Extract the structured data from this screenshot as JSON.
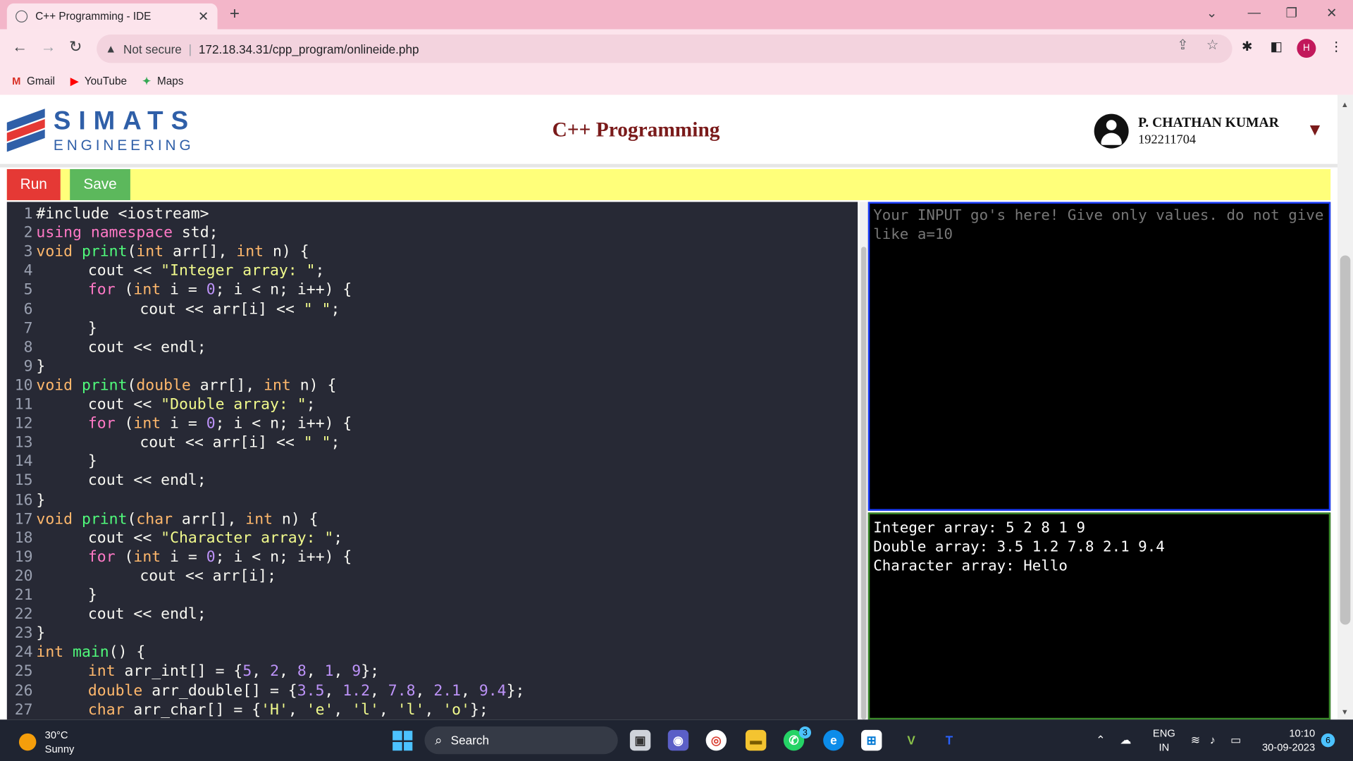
{
  "browser": {
    "tab_title": "C++ Programming - IDE",
    "new_tab": "+",
    "security": "Not secure",
    "url": "172.18.34.31/cpp_program/onlineide.php",
    "avatar_initial": "H",
    "bookmarks": [
      {
        "label": "Gmail",
        "icon": "gmail-icon"
      },
      {
        "label": "YouTube",
        "icon": "youtube-icon"
      },
      {
        "label": "Maps",
        "icon": "maps-icon"
      }
    ]
  },
  "header": {
    "logo_line1": "SIMATS",
    "logo_line2": "ENGINEERING",
    "title": "C++ Programming",
    "user_name": "P. CHATHAN KUMAR",
    "user_id": "192211704"
  },
  "actions": {
    "run_label": "Run",
    "save_label": "Save"
  },
  "input": {
    "placeholder": "Your INPUT go's here! Give only values. do not give like a=10"
  },
  "output": {
    "lines": [
      "Integer array: 5 2 8 1 9",
      "Double array: 3.5 1.2 7.8 2.1 9.4",
      "Character array: Hello"
    ]
  },
  "editor": {
    "line_numbers": [
      "1",
      "2",
      "3",
      "4",
      "5",
      "6",
      "7",
      "8",
      "9",
      "10",
      "11",
      "12",
      "13",
      "14",
      "15",
      "16",
      "17",
      "18",
      "19",
      "20",
      "21",
      "22",
      "23",
      "24",
      "25",
      "26",
      "27"
    ],
    "lines": [
      "#include <iostream>",
      "using namespace std;",
      "void print(int arr[], int n) {",
      "\tcout << \"Integer array: \";",
      "\tfor (int i = 0; i < n; i++) {",
      "\t\tcout << arr[i] << \" \";",
      "\t}",
      "\tcout << endl;",
      "}",
      "void print(double arr[], int n) {",
      "\tcout << \"Double array: \";",
      "\tfor (int i = 0; i < n; i++) {",
      "\t\tcout << arr[i] << \" \";",
      "\t}",
      "\tcout << endl;",
      "}",
      "void print(char arr[], int n) {",
      "\tcout << \"Character array: \";",
      "\tfor (int i = 0; i < n; i++) {",
      "\t\tcout << arr[i];",
      "\t}",
      "\tcout << endl;",
      "}",
      "int main() {",
      "\tint arr_int[] = {5, 2, 8, 1, 9};",
      "\tdouble arr_double[] = {3.5, 1.2, 7.8, 2.1, 9.4};",
      "\tchar arr_char[] = {'H', 'e', 'l', 'l', 'o'};"
    ]
  },
  "taskbar": {
    "temperature": "30°C",
    "weather": "Sunny",
    "search": "Search",
    "lang1": "ENG",
    "lang2": "IN",
    "time": "10:10",
    "date": "30-09-2023",
    "notifications": "6",
    "whatsapp_badge": "3"
  }
}
